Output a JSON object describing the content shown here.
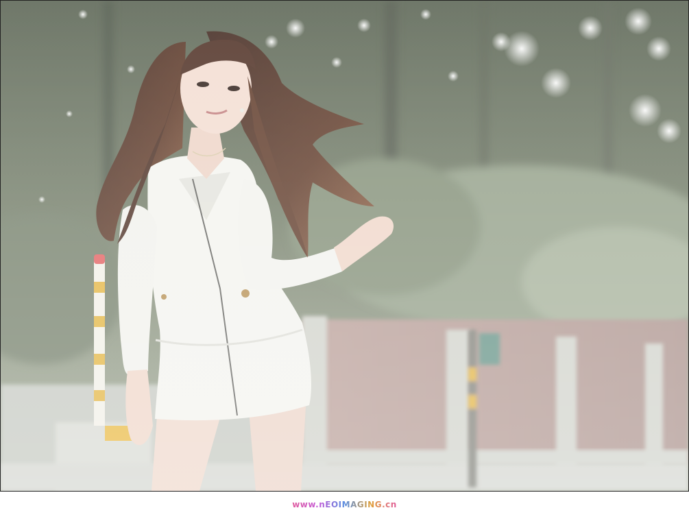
{
  "watermark": {
    "text": "www.nEOIMAGING.cn"
  },
  "photo": {
    "subject": "woman-in-white-hoodie-dress",
    "palette": {
      "foliage_dark": "#3f4a3a",
      "foliage_light": "#9fae92",
      "brick_wall": "#a58a82",
      "pavement": "#c9ccc6",
      "hair": "#4a2a1e",
      "dress": "#f3f3ee",
      "skin": "#f1d9cc",
      "pole_yellow": "#e2b23a"
    }
  }
}
